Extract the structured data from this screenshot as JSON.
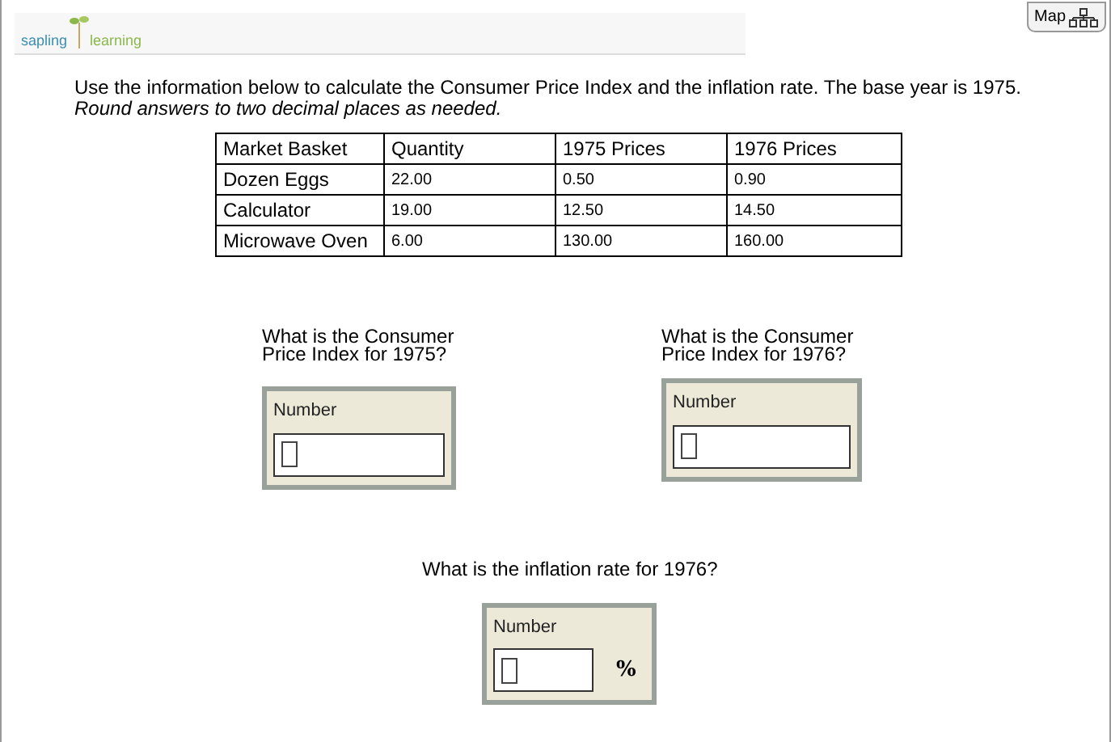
{
  "header": {
    "logo_left": "sapling",
    "logo_right": "learning",
    "map_button": "Map"
  },
  "instructions": {
    "text": "Use the information below to calculate the Consumer Price Index and the inflation rate. The base year is 1975.",
    "note": "Round answers to two decimal places as needed."
  },
  "table": {
    "columns": [
      "Market Basket",
      "Quantity",
      "1975 Prices",
      "1976 Prices"
    ],
    "rows": [
      [
        "Dozen Eggs",
        "22.00",
        "0.50",
        "0.90"
      ],
      [
        "Calculator",
        "19.00",
        "12.50",
        "14.50"
      ],
      [
        "Microwave Oven",
        "6.00",
        "130.00",
        "160.00"
      ]
    ]
  },
  "questions": [
    {
      "text": "What is the Consumer Price Index for 1975?",
      "label": "Number"
    },
    {
      "text": "What is the Consumer Price Index for 1976?",
      "label": "Number"
    },
    {
      "text": "What is the inflation rate for 1976?",
      "label": "Number",
      "suffix": "%"
    }
  ]
}
